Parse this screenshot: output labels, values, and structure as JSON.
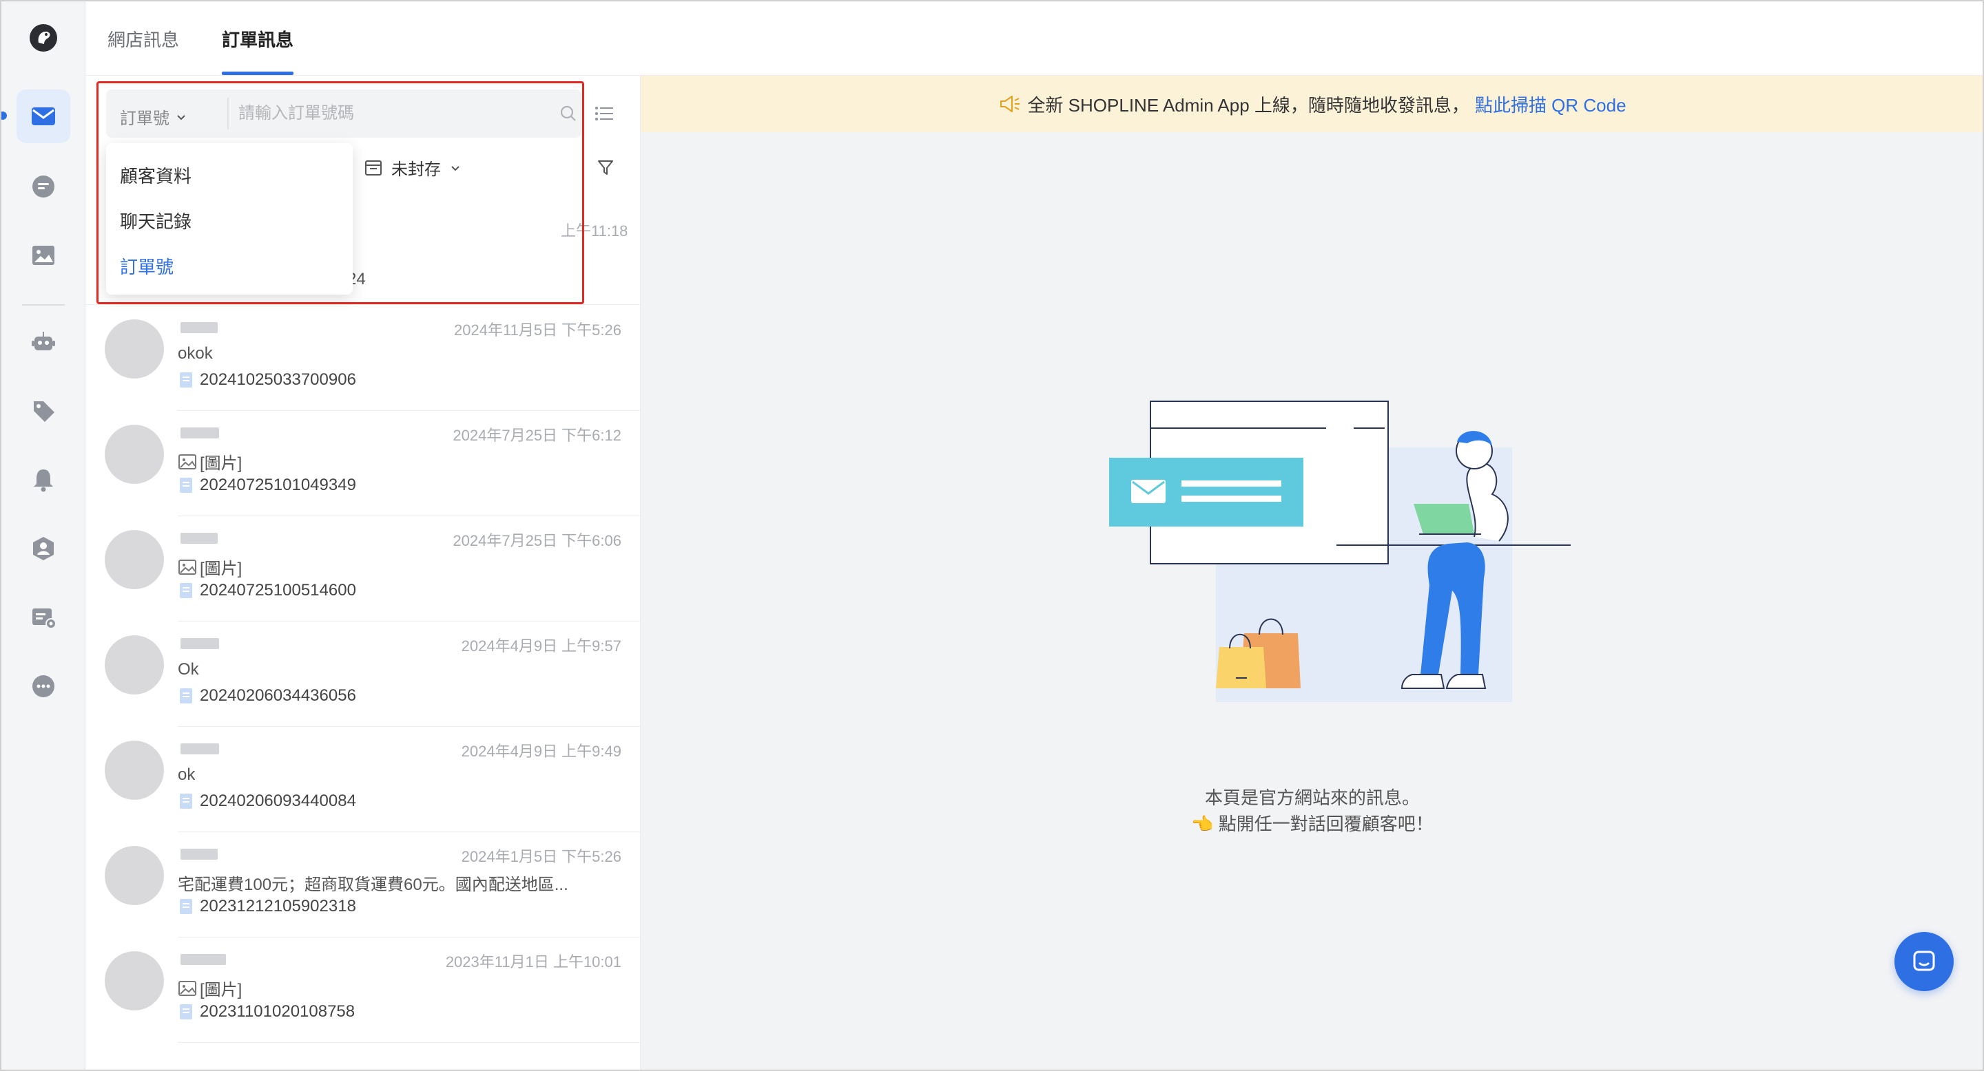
{
  "header": {
    "tabs": [
      {
        "label": "網店訊息",
        "active": false
      },
      {
        "label": "訂單訊息",
        "active": true
      }
    ]
  },
  "sidebar": {
    "items": [
      {
        "icon": "mail-icon",
        "active": true
      },
      {
        "icon": "chat-icon"
      },
      {
        "icon": "image-icon"
      },
      {
        "icon": "robot-icon"
      },
      {
        "icon": "tag-icon"
      },
      {
        "icon": "bell-icon"
      },
      {
        "icon": "user-badge-icon"
      },
      {
        "icon": "message-settings-icon"
      },
      {
        "icon": "more-icon"
      }
    ]
  },
  "search": {
    "type_label": "訂單號",
    "placeholder": "請輸入訂單號碼"
  },
  "filter": {
    "archive_label": "未封存"
  },
  "dropdown": {
    "options": [
      {
        "label": "顧客資料",
        "selected": false
      },
      {
        "label": "聊天記錄",
        "selected": false
      },
      {
        "label": "訂單號",
        "selected": true
      }
    ]
  },
  "first_conversation": {
    "time": "上午11:18",
    "order_fragment": "24"
  },
  "conversations": [
    {
      "time": "2024年11月5日 下午5:26",
      "message": "okok",
      "order": "20241025033700906",
      "image": false
    },
    {
      "time": "2024年7月25日 下午6:12",
      "message": "[圖片]",
      "order": "20240725101049349",
      "image": true
    },
    {
      "time": "2024年7月25日 下午6:06",
      "message": "[圖片]",
      "order": "20240725100514600",
      "image": true
    },
    {
      "time": "2024年4月9日 上午9:57",
      "message": "Ok",
      "order": "20240206034436056",
      "image": false
    },
    {
      "time": "2024年4月9日 上午9:49",
      "message": "ok",
      "order": "20240206093440084",
      "image": false
    },
    {
      "time": "2024年1月5日 下午5:26",
      "message": "宅配運費100元；超商取貨運費60元。國內配送地區...",
      "order": "20231212105902318",
      "image": false
    },
    {
      "time": "2023年11月1日 上午10:01",
      "message": "[圖片]",
      "order": "20231101020108758",
      "image": true
    }
  ],
  "banner": {
    "text": "全新 SHOPLINE Admin App 上線，隨時隨地收發訊息，",
    "link": "點此掃描 QR Code"
  },
  "empty_state": {
    "line1": "本頁是官方網站來的訊息。",
    "line2": "👈 點開任一對話回覆顧客吧！"
  },
  "colors": {
    "accent": "#2f6fe4",
    "banner_bg": "#fcf2d8",
    "highlight": "#e02a21"
  }
}
